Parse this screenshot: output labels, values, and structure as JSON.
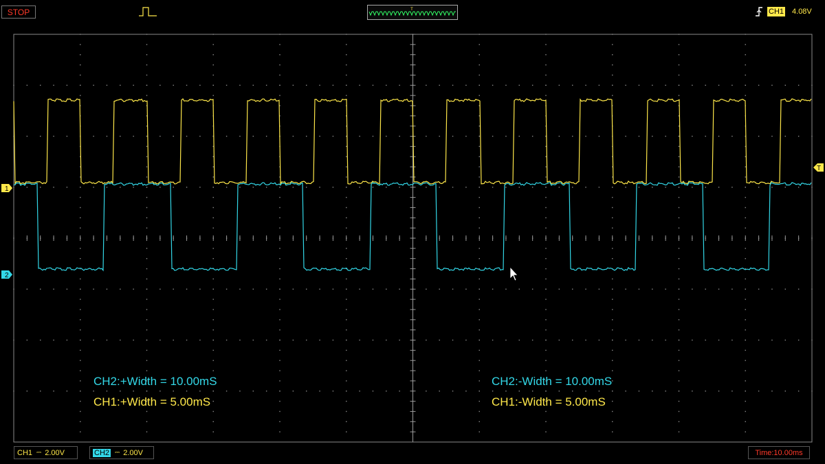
{
  "status": {
    "run_state": "STOP"
  },
  "trigger": {
    "channel": "CH1",
    "level": "4.08V",
    "marker": "T"
  },
  "channels": {
    "ch1": {
      "name": "CH1",
      "scale": "2.00V",
      "color": "#ffe84a",
      "marker": "1"
    },
    "ch2": {
      "name": "CH2",
      "scale": "2.00V",
      "color": "#33d8e8",
      "marker": "2"
    }
  },
  "timebase": {
    "label": "Time:10.00ms"
  },
  "measurements": {
    "ch2_pos_width": "CH2:+Width = 10.00mS",
    "ch1_pos_width": "CH1:+Width = 5.00mS",
    "ch2_neg_width": "CH2:-Width = 10.00mS",
    "ch1_neg_width": "CH1:-Width = 5.00mS"
  },
  "colors": {
    "grid": "#8a8a8a",
    "background": "#000000",
    "stop": "#ff3a2a"
  }
}
